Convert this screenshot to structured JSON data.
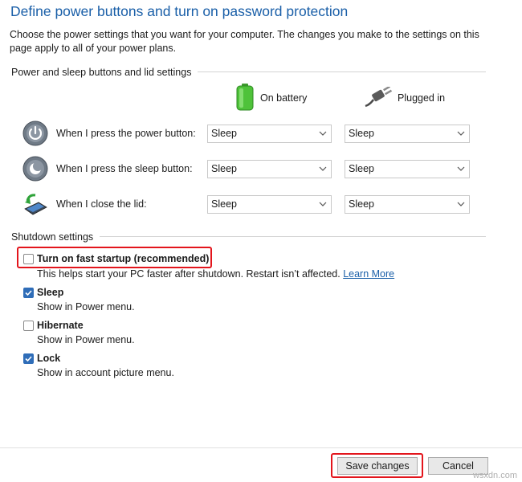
{
  "header": {
    "title": "Define power buttons and turn on password protection",
    "description": "Choose the power settings that you want for your computer. The changes you make to the settings on this page apply to all of your power plans."
  },
  "power_section": {
    "heading": "Power and sleep buttons and lid settings",
    "columns": {
      "battery": "On battery",
      "plugged": "Plugged in"
    },
    "rows": [
      {
        "label": "When I press the power button:",
        "icon": "power-button-icon",
        "battery": "Sleep",
        "plugged": "Sleep"
      },
      {
        "label": "When I press the sleep button:",
        "icon": "sleep-button-icon",
        "battery": "Sleep",
        "plugged": "Sleep"
      },
      {
        "label": "When I close the lid:",
        "icon": "laptop-lid-icon",
        "battery": "Sleep",
        "plugged": "Sleep"
      }
    ]
  },
  "shutdown_section": {
    "heading": "Shutdown settings",
    "options": [
      {
        "label": "Turn on fast startup (recommended)",
        "checked": false,
        "description": "This helps start your PC faster after shutdown. Restart isn’t affected.",
        "link": "Learn More"
      },
      {
        "label": "Sleep",
        "checked": true,
        "description": "Show in Power menu."
      },
      {
        "label": "Hibernate",
        "checked": false,
        "description": "Show in Power menu."
      },
      {
        "label": "Lock",
        "checked": true,
        "description": "Show in account picture menu."
      }
    ]
  },
  "footer": {
    "save_label": "Save changes",
    "cancel_label": "Cancel"
  },
  "watermark": "wsxdn.com",
  "colors": {
    "title": "#1a5fa8",
    "checkbox_checked": "#2f6db8",
    "highlight": "#e3151c"
  }
}
